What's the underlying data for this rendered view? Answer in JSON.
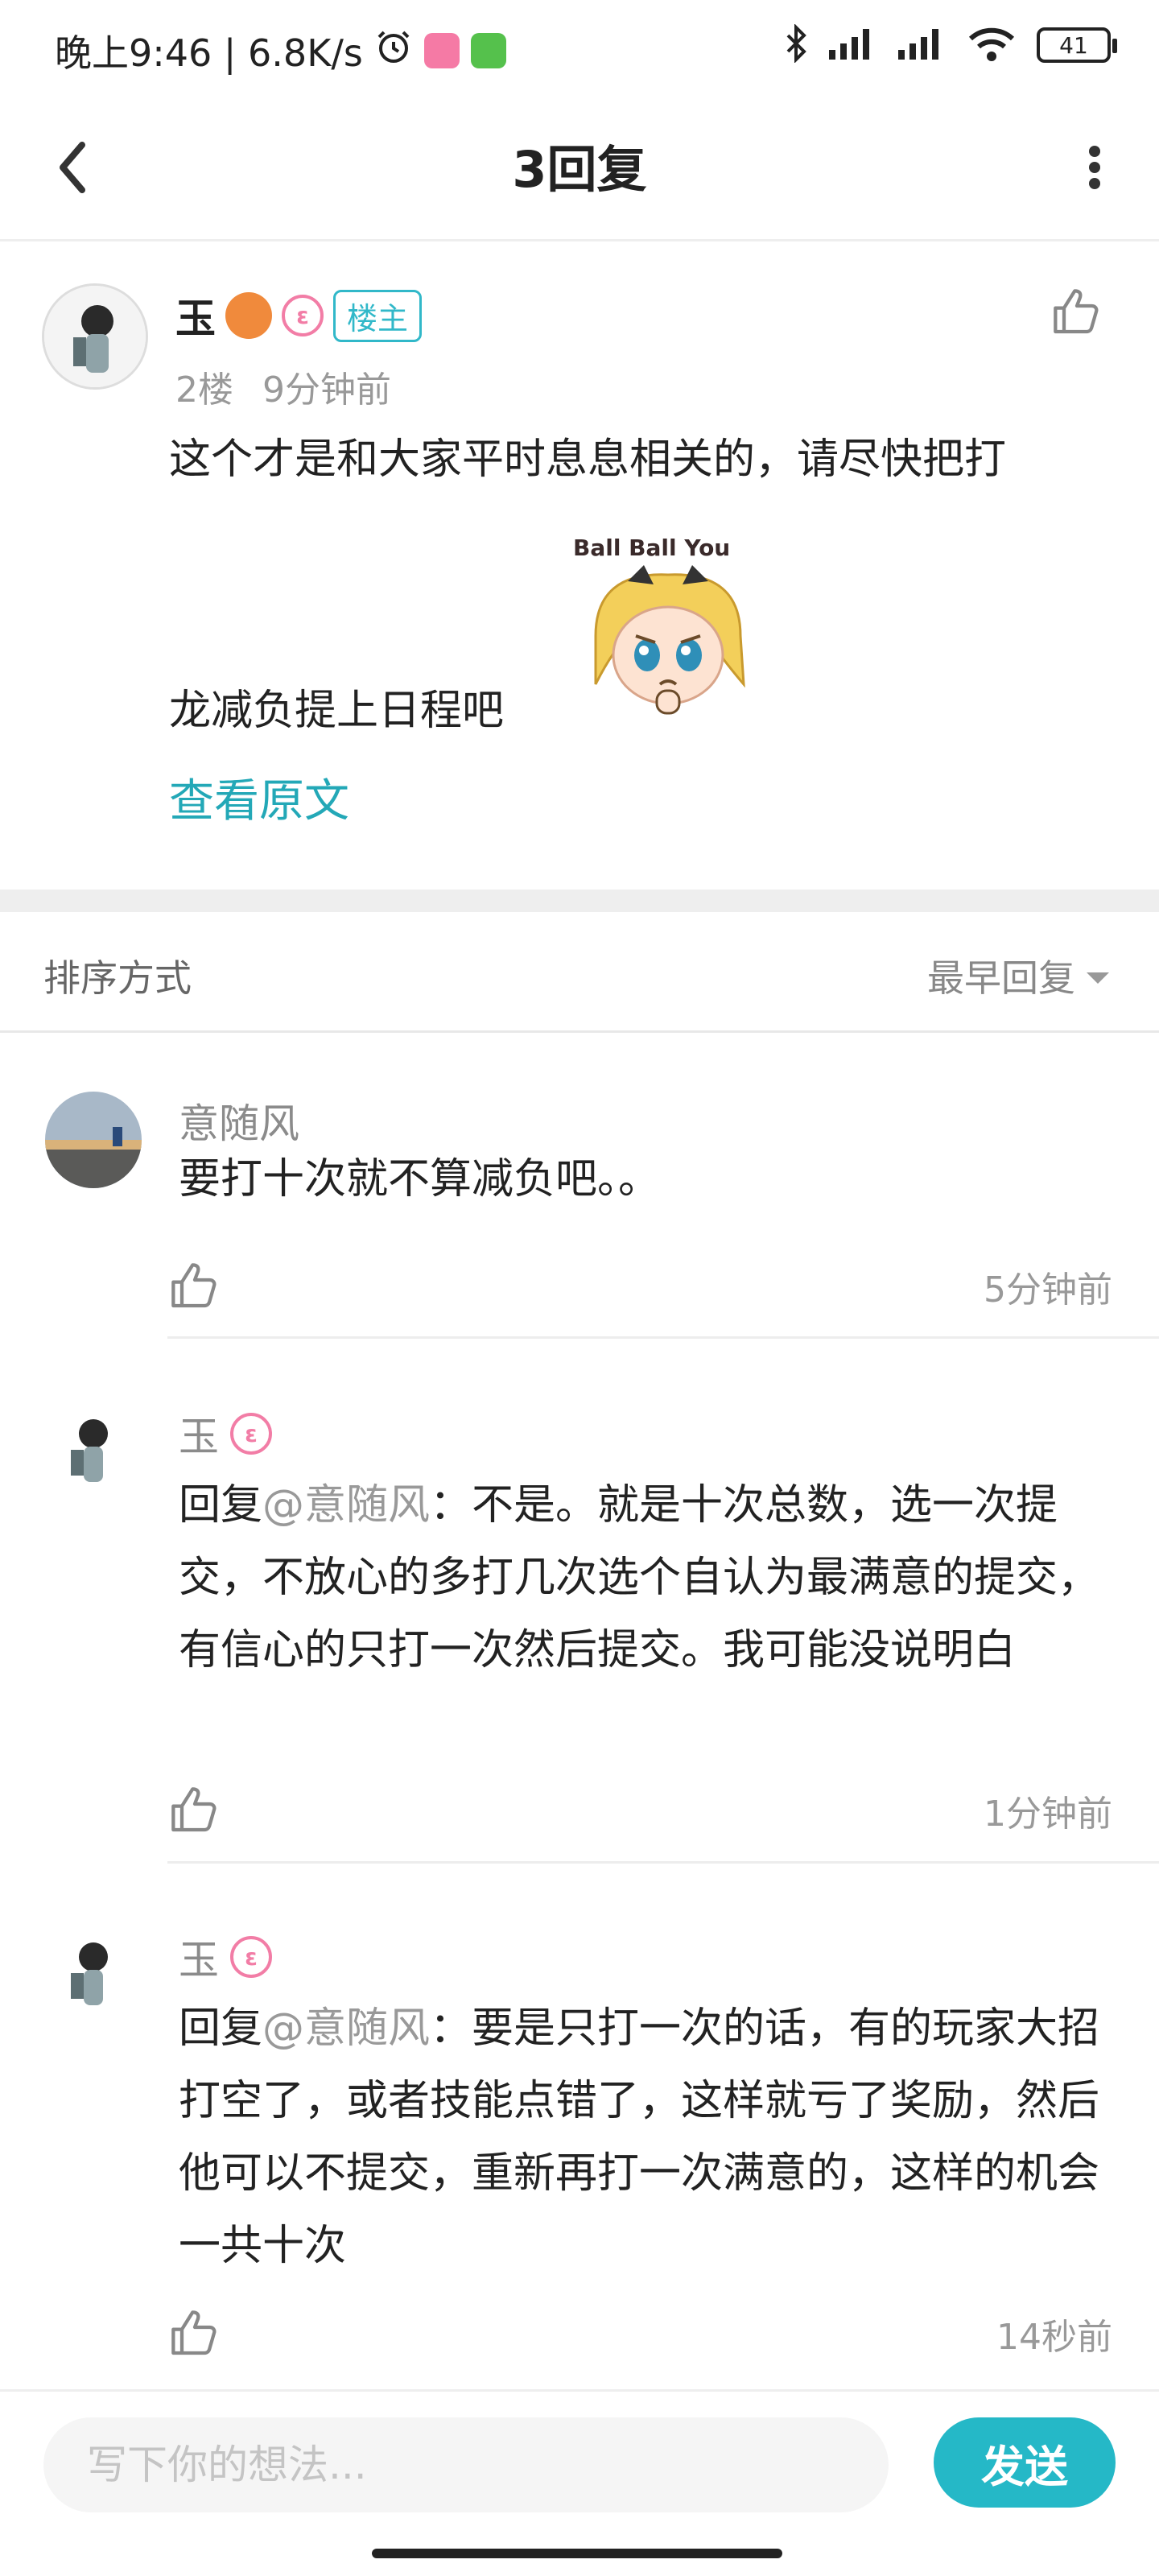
{
  "status_bar": {
    "time_speed": "晚上9:46 | 6.8K/s",
    "battery": "41"
  },
  "header": {
    "title": "3回复"
  },
  "post": {
    "author": "玉",
    "owner_tag": "楼主",
    "floor": "2楼",
    "time": "9分钟前",
    "text_line1": "这个才是和大家平时息息相关的，请尽快把打",
    "text_line2": "龙减负提上日程吧",
    "sticker_text": "Ball Ball You",
    "view_original": "查看原文"
  },
  "sort": {
    "label": "排序方式",
    "value": "最早回复"
  },
  "replies": [
    {
      "author": "意随风",
      "text": "要打十次就不算减负吧。。",
      "mention": "",
      "time": "5分钟前"
    },
    {
      "author": "玉",
      "prefix": "回复",
      "mention": "@意随风",
      "text": "：不是。就是十次总数，选一次提交，不放心的多打几次选个自认为最满意的提交，有信心的只打一次然后提交。我可能没说明白",
      "time": "1分钟前"
    },
    {
      "author": "玉",
      "prefix": "回复",
      "mention": "@意随风",
      "text": "：要是只打一次的话，有的玩家大招打空了，或者技能点错了，这样就亏了奖励，然后他可以不提交，重新再打一次满意的，这样的机会一共十次",
      "time": "14秒前"
    }
  ],
  "input_bar": {
    "placeholder": "写下你的想法...",
    "send_label": "发送"
  },
  "colors": {
    "accent": "#25b8c7",
    "owner_tag": "#31b8c9",
    "pink_badge": "#f27da6"
  }
}
